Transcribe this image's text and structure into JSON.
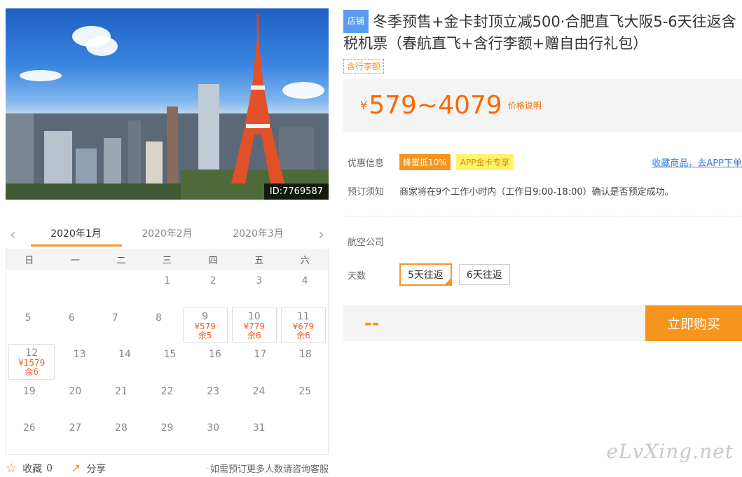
{
  "hero": {
    "id_tag": "ID:7769587"
  },
  "calendar": {
    "months": [
      "2020年1月",
      "2020年2月",
      "2020年3月"
    ],
    "weekdays": [
      "日",
      "一",
      "二",
      "三",
      "四",
      "五",
      "六"
    ],
    "weeks": [
      [
        null,
        null,
        null,
        {
          "d": "1"
        },
        {
          "d": "2"
        },
        {
          "d": "3"
        },
        {
          "d": "4"
        }
      ],
      [
        {
          "d": "5"
        },
        {
          "d": "6"
        },
        {
          "d": "7"
        },
        {
          "d": "8"
        },
        {
          "d": "9",
          "p": "¥579",
          "r": "余5"
        },
        {
          "d": "10",
          "p": "¥779",
          "r": "余6"
        },
        {
          "d": "11",
          "p": "¥679",
          "r": "余6"
        }
      ],
      [
        {
          "d": "12",
          "p": "¥1579",
          "r": "余6"
        },
        {
          "d": "13"
        },
        {
          "d": "14"
        },
        {
          "d": "15"
        },
        {
          "d": "16"
        },
        {
          "d": "17"
        },
        {
          "d": "18"
        }
      ],
      [
        {
          "d": "19"
        },
        {
          "d": "20"
        },
        {
          "d": "21"
        },
        {
          "d": "22"
        },
        {
          "d": "23"
        },
        {
          "d": "24"
        },
        {
          "d": "25"
        }
      ],
      [
        {
          "d": "26"
        },
        {
          "d": "27"
        },
        {
          "d": "28"
        },
        {
          "d": "29"
        },
        {
          "d": "30"
        },
        {
          "d": "31"
        },
        null
      ]
    ]
  },
  "footer": {
    "fav_label": "收藏",
    "fav_count": "0",
    "share_label": "分享",
    "note": "如需预订更多人数请咨询客服"
  },
  "product": {
    "store_badge": "店铺",
    "title": "冬季预售+金卡封顶立减500·合肥直飞大阪5-6天往返含税机票（春航直飞+含行李额+赠自由行礼包）",
    "tax_tag": "含行李额",
    "currency": "¥",
    "price": "579~4079",
    "price_note": "价格说明"
  },
  "info": {
    "promo_label": "优惠信息",
    "promo_badge1": "蜂蜜抵10%",
    "promo_badge2": "APP金卡专享",
    "promo_link": "收藏商品，去APP下单",
    "notice_label": "预订须知",
    "notice_text": "商家将在9个工作小时内（工作日9:00-18:00）确认是否预定成功。"
  },
  "options": {
    "airline_label": "航空公司",
    "days_label": "天数",
    "days": [
      "5天往返",
      "6天往返"
    ]
  },
  "buy": {
    "qty": "--",
    "button": "立即购买"
  },
  "watermark": "eLvXing.net",
  "colors": {
    "accent": "#f7941d",
    "price": "#ff6600",
    "link": "#3a7ad9",
    "store": "#5b9cf0"
  }
}
